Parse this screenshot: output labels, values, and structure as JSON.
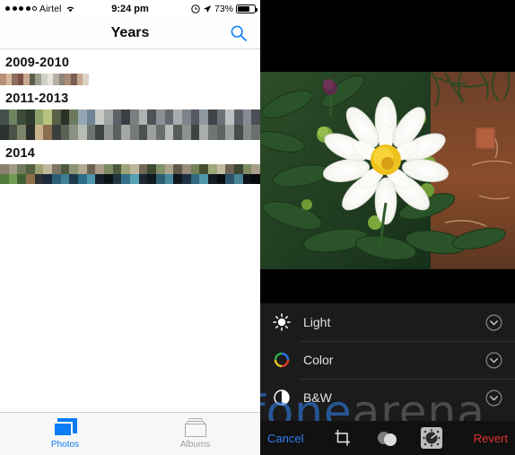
{
  "left": {
    "status_bar": {
      "signal_dots_filled": 4,
      "signal_dots_total": 5,
      "carrier": "Airtel",
      "wifi_icon": "wifi-icon",
      "time": "9:24 pm",
      "alarm_icon": "alarm-icon",
      "location_icon": "location-arrow-icon",
      "battery_percent": "73%",
      "battery_level": 73
    },
    "navbar": {
      "title": "Years",
      "search_icon": "search-icon"
    },
    "years": [
      {
        "label": "2009-2010",
        "rows": 1,
        "strip_height": 13,
        "strip_width_pct": 34,
        "colors": [
          [
            "#b9907a",
            "#d8b79c",
            "#8e6f5e",
            "#7d4f4a",
            "#c7a98f",
            "#5d5f4c",
            "#9aa08c",
            "#cfcfc6",
            "#e6e3dc",
            "#b6b0a4",
            "#8f8478",
            "#a98c78",
            "#7b5f52",
            "#c9a78f",
            "#dcd3c6"
          ]
        ]
      },
      {
        "label": "2011-2013",
        "rows": 2,
        "strip_height": 34,
        "strip_width_pct": 100,
        "colors": [
          [
            "#46504a",
            "#6f8360",
            "#3c4a38",
            "#2e3a2c",
            "#8fa06a",
            "#b6c27d",
            "#586048",
            "#2a3226",
            "#6d7a5e",
            "#94a7b4",
            "#6f8596",
            "#c6c9c4",
            "#9fa6a3",
            "#5c6268",
            "#3b3f44",
            "#7a7f82",
            "#b0b3b2",
            "#4e5358",
            "#8b9095",
            "#626a70",
            "#a7acae",
            "#7c8389",
            "#545a60",
            "#9098a0",
            "#3f4449",
            "#6b7278",
            "#bcc0c2",
            "#5a6066",
            "#868c92",
            "#4a5056"
          ],
          [
            "#2c3230",
            "#4a5146",
            "#7b8468",
            "#2a2e2a",
            "#c9b28a",
            "#8d6f4f",
            "#3a3f3b",
            "#5b6356",
            "#8a9184",
            "#b8bdb6",
            "#6d7470",
            "#3e4442",
            "#8f9490",
            "#5a605c",
            "#a3a8a4",
            "#747a76",
            "#4b5150",
            "#9ba09c",
            "#686e6a",
            "#b7bcb8",
            "#565c58",
            "#8c9290",
            "#3d4341",
            "#a9aeaa",
            "#707672",
            "#5e6460",
            "#9aa09c",
            "#464c48",
            "#838986",
            "#6a706c"
          ]
        ]
      },
      {
        "label": "2014",
        "rows": 2,
        "strip_height": 22,
        "strip_width_pct": 100,
        "colors": [
          [
            "#8b7f6e",
            "#a39a86",
            "#6e7a5c",
            "#53603f",
            "#9aa272",
            "#c0b89c",
            "#7e7463",
            "#4e5a3c",
            "#8c9474",
            "#b3a890",
            "#6a6352",
            "#a89c86",
            "#7c8a64",
            "#4d5a3e",
            "#9ba274",
            "#bfb69e",
            "#6f6857",
            "#3e4a32",
            "#84906a",
            "#ada492",
            "#5f5a4b",
            "#978d7a",
            "#748056",
            "#44502f",
            "#9fa878",
            "#c4bca2",
            "#6b6454",
            "#3a4630",
            "#7e8a62",
            "#a69d8a"
          ],
          [
            "#4f7a3e",
            "#6f9c52",
            "#3e6030",
            "#8b6f4a",
            "#2b2f33",
            "#1b2a3a",
            "#2d5f74",
            "#3f8096",
            "#1d3a4c",
            "#2a6d84",
            "#4f96ab",
            "#16212b",
            "#0d1418",
            "#223441",
            "#35708a",
            "#56a0b4",
            "#1a2833",
            "#101820",
            "#2e5e72",
            "#49899d",
            "#0f171d",
            "#1e3140",
            "#33687f",
            "#5197aa",
            "#121b22",
            "#0a0f13",
            "#2b5468",
            "#478394",
            "#0d1216",
            "#070a0c"
          ]
        ]
      }
    ],
    "tabs": [
      {
        "label": "Photos",
        "icon": "photos-stack-icon",
        "active": true
      },
      {
        "label": "Albums",
        "icon": "albums-icon",
        "active": false
      }
    ]
  },
  "right": {
    "photo": {
      "alt_name": "white-dahlia-flower-photo",
      "subject": "white dahlia flower with green foliage and red soil"
    },
    "edit_options": [
      {
        "label": "Light",
        "icon": "brightness-sun-icon",
        "chevron": "chevron-down-circle-icon"
      },
      {
        "label": "Color",
        "icon": "color-wheel-icon",
        "chevron": "chevron-down-circle-icon"
      },
      {
        "label": "B&W",
        "icon": "black-white-contrast-icon",
        "chevron": "chevron-down-circle-icon"
      }
    ],
    "toolbar": {
      "cancel_label": "Cancel",
      "revert_label": "Revert",
      "crop_icon": "crop-rotate-icon",
      "filters_icon": "filters-icon",
      "adjust_icon": "adjust-dial-icon",
      "cancel_color": "#2f7ff0",
      "revert_color": "#e0302a"
    }
  },
  "watermark": {
    "part1": "fone",
    "part2": "arena"
  }
}
